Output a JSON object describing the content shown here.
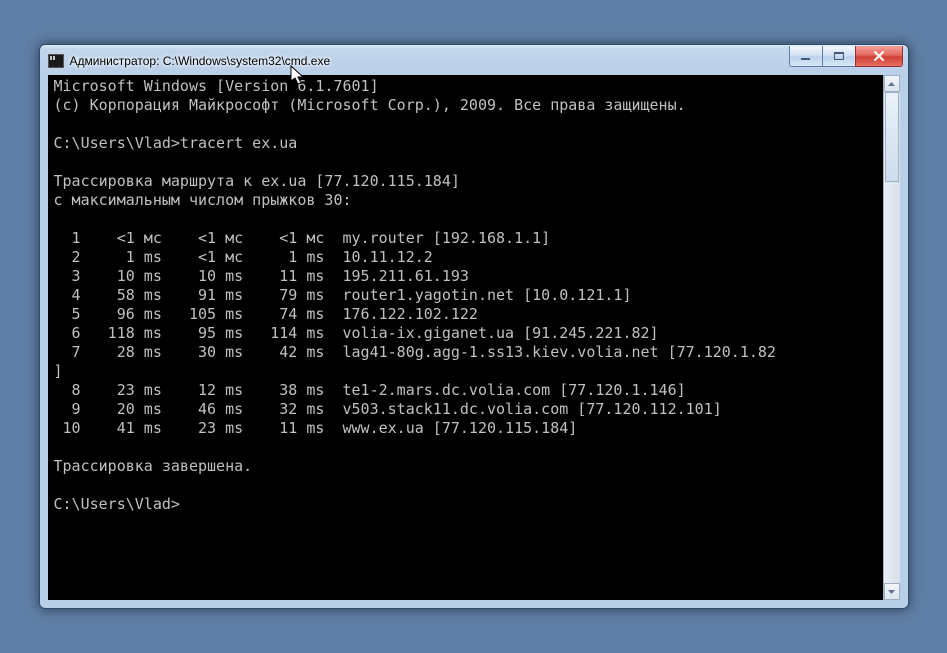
{
  "window": {
    "title": "Администратор: C:\\Windows\\system32\\cmd.exe"
  },
  "console": {
    "lines": [
      "Microsoft Windows [Version 6.1.7601]",
      "(c) Корпорация Майкрософт (Microsoft Corp.), 2009. Все права защищены.",
      "",
      "C:\\Users\\Vlad>tracert ex.ua",
      "",
      "Трассировка маршрута к ex.ua [77.120.115.184]",
      "с максимальным числом прыжков 30:",
      "",
      "  1    <1 мс    <1 мс    <1 мс  my.router [192.168.1.1]",
      "  2     1 ms    <1 мс     1 ms  10.11.12.2",
      "  3    10 ms    10 ms    11 ms  195.211.61.193",
      "  4    58 ms    91 ms    79 ms  router1.yagotin.net [10.0.121.1]",
      "  5    96 ms   105 ms    74 ms  176.122.102.122",
      "  6   118 ms    95 ms   114 ms  volia-ix.giganet.ua [91.245.221.82]",
      "  7    28 ms    30 ms    42 ms  lag41-80g.agg-1.ss13.kiev.volia.net [77.120.1.82",
      "]",
      "  8    23 ms    12 ms    38 ms  te1-2.mars.dc.volia.com [77.120.1.146]",
      "  9    20 ms    46 ms    32 ms  v503.stack11.dc.volia.com [77.120.112.101]",
      " 10    41 ms    23 ms    11 ms  www.ex.ua [77.120.115.184]",
      "",
      "Трассировка завершена.",
      "",
      "C:\\Users\\Vlad>"
    ]
  }
}
